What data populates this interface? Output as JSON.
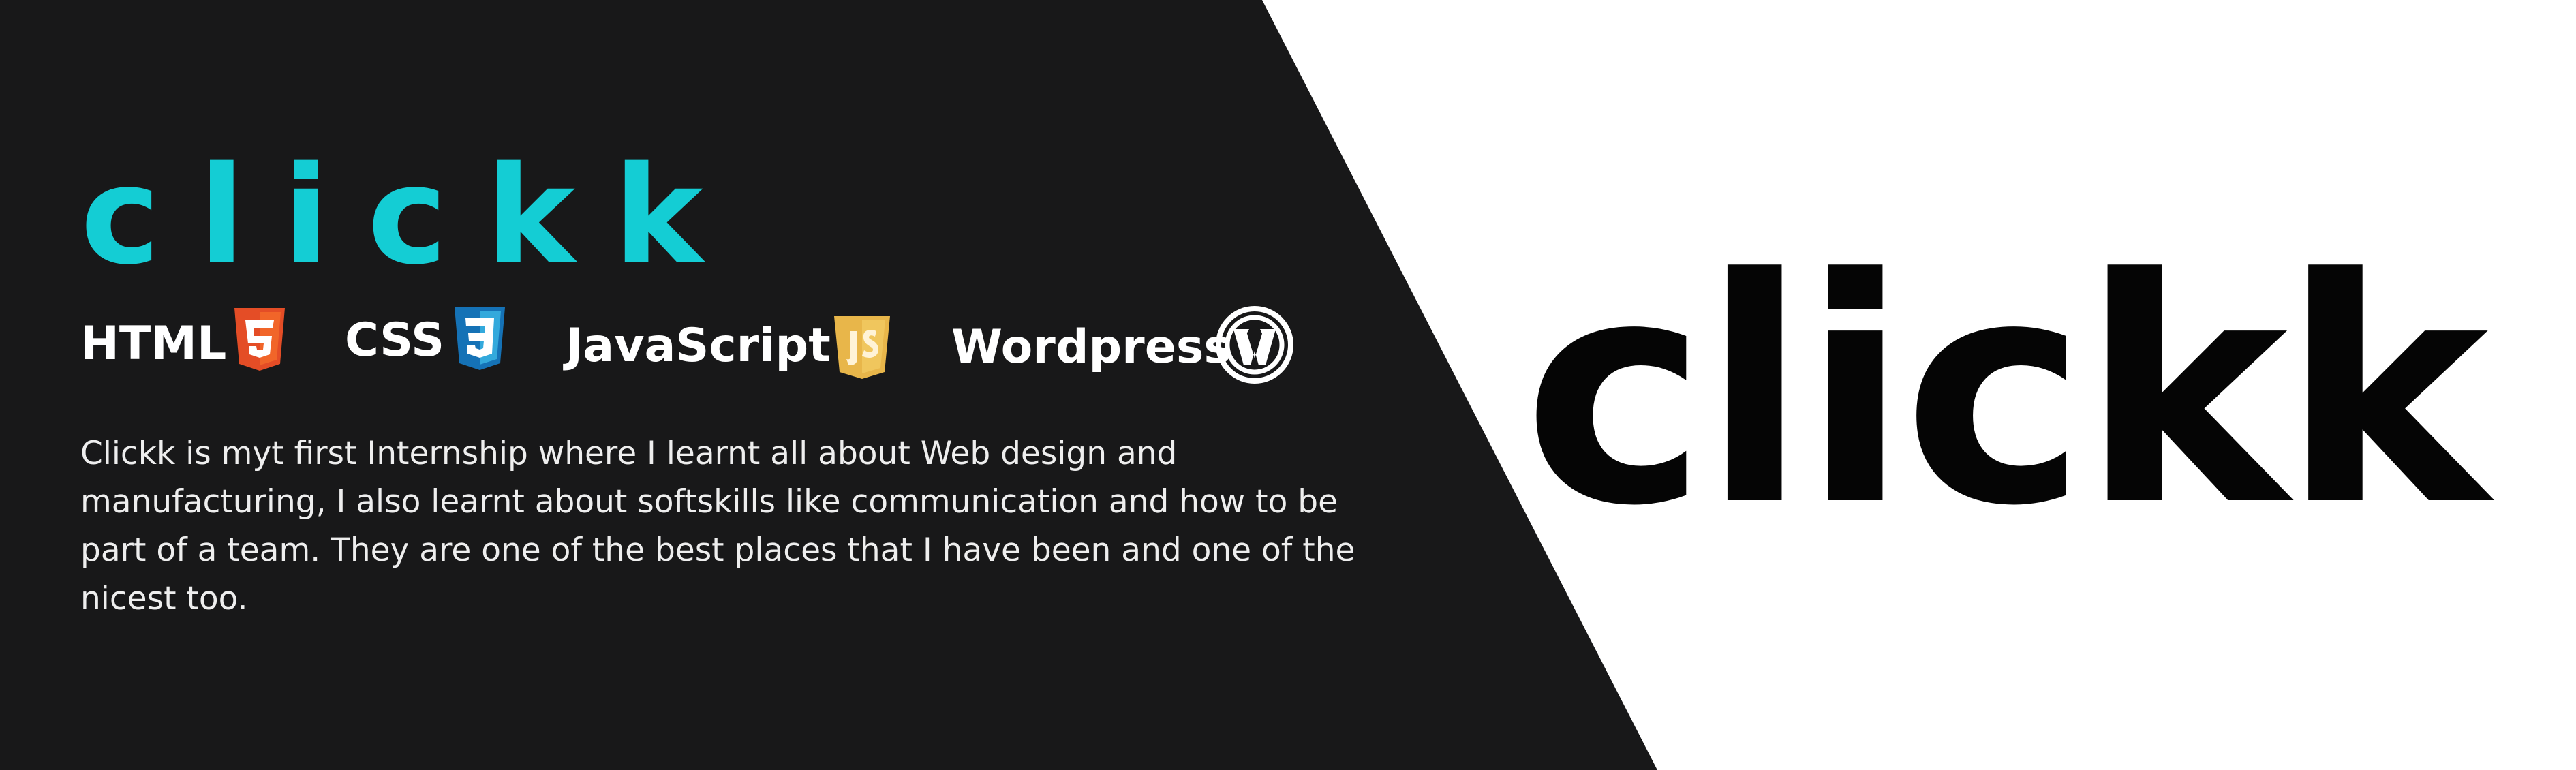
{
  "brand": {
    "title": "clickk",
    "accent": "#14cdd4"
  },
  "technologies": [
    {
      "label": "HTML",
      "icon": "html5-icon",
      "color": "#e44d26"
    },
    {
      "label": "CSS",
      "icon": "css3-icon",
      "color": "#1572b6"
    },
    {
      "label": "JavaScript",
      "icon": "javascript-icon",
      "color": "#e8b64a"
    },
    {
      "label": "Wordpress",
      "icon": "wordpress-icon",
      "color": "#ffffff"
    }
  ],
  "description": "Clickk is myt first Internship where I learnt all about Web design and\nmanufacturing, I also learnt about softskills like communication and how to be\npart of a team. They are one of the best places that I have been and one of the\nnicest too.",
  "logo": {
    "text": "clickk",
    "color": "#050505"
  },
  "colors": {
    "background": "#181819",
    "panel_right": "#ffffff"
  }
}
